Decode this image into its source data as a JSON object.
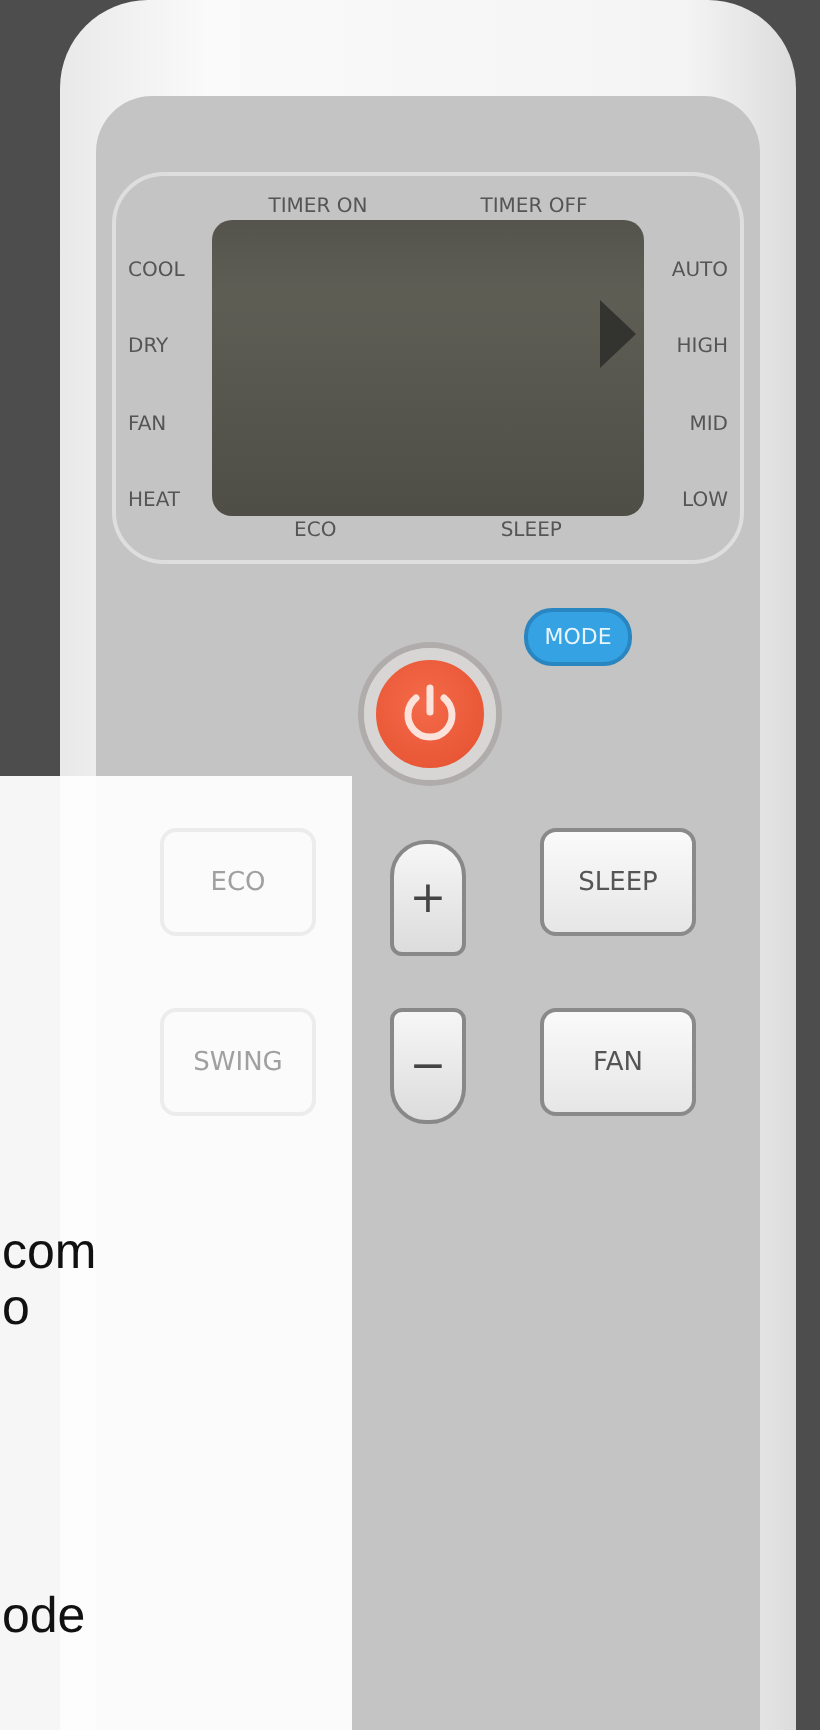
{
  "display": {
    "top_labels": [
      "TIMER ON",
      "TIMER OFF"
    ],
    "mode_labels": [
      "COOL",
      "DRY",
      "FAN",
      "HEAT"
    ],
    "fan_speeds": [
      {
        "label": "AUTO",
        "selected": false
      },
      {
        "label": "HIGH",
        "selected": true
      },
      {
        "label": "MID",
        "selected": false
      },
      {
        "label": "LOW",
        "selected": false
      }
    ],
    "bottom_labels": [
      "ECO",
      "SLEEP"
    ]
  },
  "buttons": {
    "mode": "MODE",
    "plus": "+",
    "minus": "−",
    "sleep": "SLEEP",
    "fan": "FAN",
    "eco": "ECO",
    "swing": "SWING"
  },
  "overlay": {
    "lines": [
      "com",
      "o"
    ],
    "footer": "ode"
  }
}
